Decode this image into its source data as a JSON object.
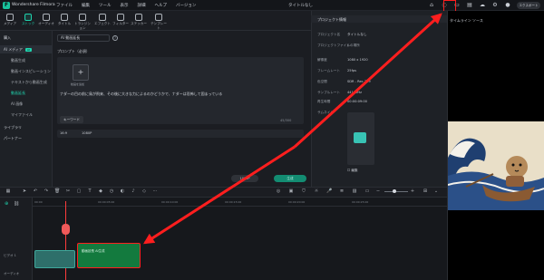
{
  "app": {
    "name": "Wondershare Filmora",
    "menu": [
      "ファイル",
      "編集",
      "ツール",
      "表示",
      "詳細",
      "ヘルプ",
      "バージョン"
    ],
    "window_title": "タイトルなし",
    "export_label": "エクスポート"
  },
  "toolbar": {
    "tabs": [
      "メディア",
      "ストック",
      "オーディオ",
      "タイトル",
      "トランジション",
      "エフェクト",
      "フィルター",
      "ステッカー",
      "テンプレート"
    ],
    "active_index": 1
  },
  "sidebar": {
    "items": [
      {
        "label": "購入"
      },
      {
        "label": "AI メディア",
        "tag": "AI"
      },
      {
        "label": "動画生成"
      },
      {
        "label": "動画インスピレーション"
      },
      {
        "label": "テキストから動画生成"
      },
      {
        "label": "動画延長"
      },
      {
        "label": "AI 画像"
      },
      {
        "label": "マイファイル"
      },
      {
        "label": "ライブラリ"
      },
      {
        "label": "パートナー"
      }
    ],
    "active_sub": "動画延長"
  },
  "generator": {
    "mode_dropdown": "AI 動画延長",
    "prompt_label": "プロンプト（必須）",
    "upload_label": "動画を追加",
    "prompt_text": "ナダーの目の前に鳥が飛来、その後に大きな力によるのかどうかで、ナダーは恐怖して固まっている",
    "keyword_button": "キーワード",
    "char_count": "45/300",
    "aspect": "16:9",
    "resolution": "1080P",
    "credits": "1080P",
    "generate_button": "生成"
  },
  "properties": {
    "title": "プロジェクト情報",
    "rows": [
      {
        "label": "プロジェクト名",
        "value": "タイトルなし"
      },
      {
        "label": "プロジェクトファイルの場所",
        "value": "/"
      },
      {
        "label": "解像度",
        "value": "1080 x 1920"
      },
      {
        "label": "フレームレート",
        "value": "25fps"
      },
      {
        "label": "色空間",
        "value": "SDR - Rec.709"
      },
      {
        "label": "サンプルレート",
        "value": "44100Hz"
      },
      {
        "label": "再生時間",
        "value": "00:00:09:00"
      },
      {
        "label": "サムネイル",
        "value": ""
      }
    ],
    "edit_label": "編集"
  },
  "preview": {
    "tabs": [
      "タイムライン",
      "ソース"
    ]
  },
  "timeline": {
    "ticks": [
      "00:00",
      "00:00:05:00",
      "00:00:10:00",
      "00:00:15:00",
      "00:00:20:00",
      "00:00:25:00"
    ],
    "clip_label": "動画延長 AI生成",
    "track_video": "ビデオ 1",
    "track_audio": "オーディオ"
  },
  "colors": {
    "accent": "#1fd3ae",
    "annotation": "#ff1e1e",
    "clip_green": "#137a3e"
  }
}
